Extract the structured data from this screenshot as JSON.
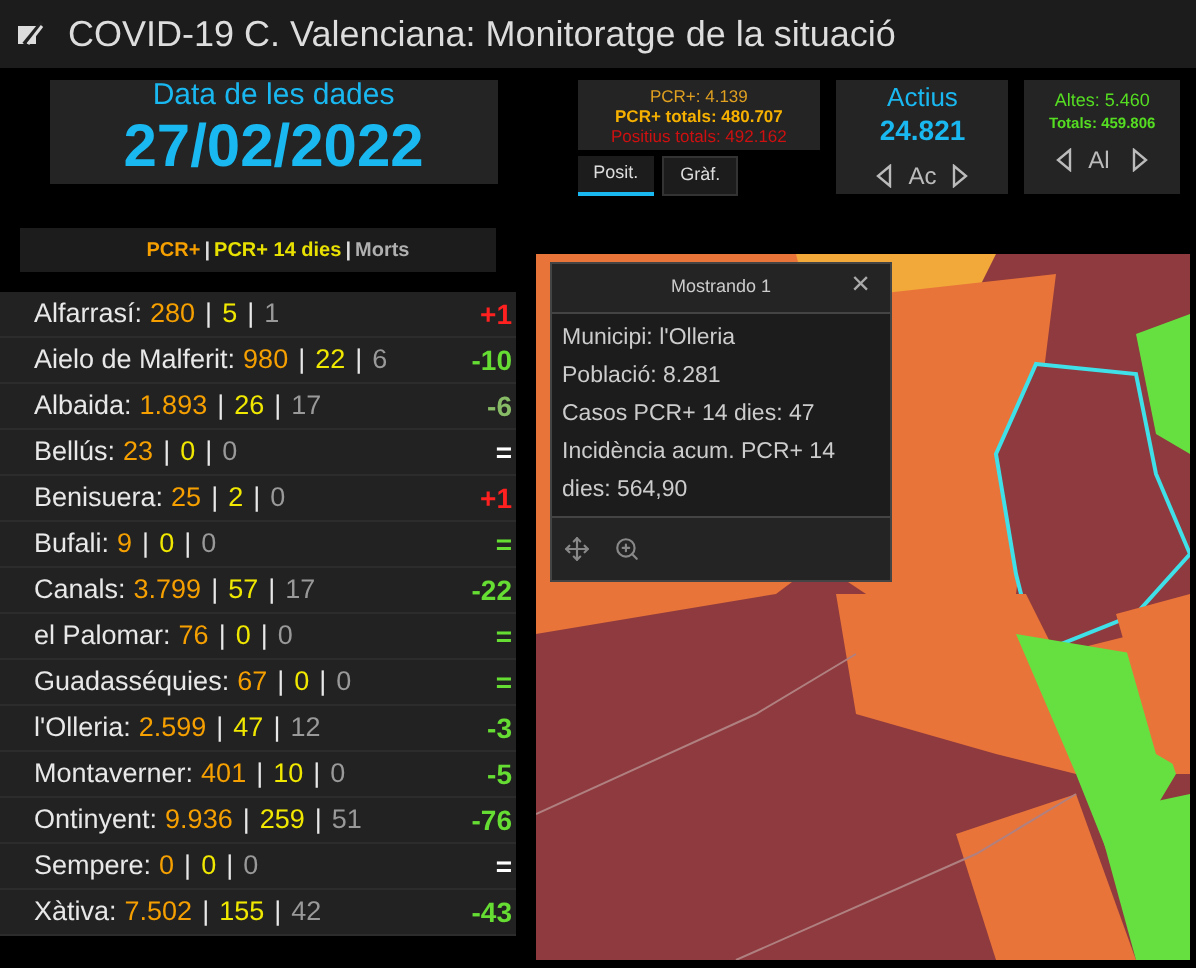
{
  "header": {
    "title": "COVID-19 C. Valenciana: Monitoratge de la situació"
  },
  "date_card": {
    "label": "Data de les dades",
    "value": "27/02/2022"
  },
  "pcr_card": {
    "lines": [
      {
        "text": "PCR+: 4.139",
        "color": "#e0a020",
        "bold": false
      },
      {
        "text": "PCR+ totals: 480.707",
        "color": "#f5b000",
        "bold": true
      },
      {
        "text": "Positius totals: 492.162",
        "color": "#d01010",
        "bold": false
      }
    ]
  },
  "pcr_tabs": [
    {
      "label": "Posit.",
      "selected": true
    },
    {
      "label": "Gràf.",
      "selected": false
    }
  ],
  "active_card": {
    "label": "Actius",
    "value": "24.821",
    "nav_label": "Ac"
  },
  "recovered_card": {
    "lines": [
      {
        "text": "Altes: 5.460",
        "bold": false
      },
      {
        "text": "Totals: 459.806",
        "bold": true
      }
    ],
    "nav_label": "Al"
  },
  "legend": [
    {
      "text": "PCR+",
      "color": "#f5a000"
    },
    {
      "text": "PCR+ 14 dies",
      "color": "#e8e000"
    },
    {
      "text": "Morts",
      "color": "#b0b0b0"
    }
  ],
  "legend_separator": "|",
  "row_separator": "|",
  "rows": [
    {
      "label": "Alfarrasí:",
      "pcr": "280",
      "pcr14": "5",
      "deaths": "1",
      "change": "+1",
      "color": "#ff2020"
    },
    {
      "label": "Aielo de Malferit:",
      "pcr": "980",
      "pcr14": "22",
      "deaths": "6",
      "change": "-10",
      "color": "#66dd33"
    },
    {
      "label": "Albaida:",
      "pcr": "1.893",
      "pcr14": "26",
      "deaths": "17",
      "change": "-6",
      "color": "#88bb66"
    },
    {
      "label": "Bellús:",
      "pcr": "23",
      "pcr14": "0",
      "deaths": "0",
      "change": "=",
      "color": "#ffffff"
    },
    {
      "label": "Benisuera:",
      "pcr": "25",
      "pcr14": "2",
      "deaths": "0",
      "change": "+1",
      "color": "#ff2020"
    },
    {
      "label": "Bufali:",
      "pcr": "9",
      "pcr14": "0",
      "deaths": "0",
      "change": "=",
      "color": "#66dd33"
    },
    {
      "label": "Canals:",
      "pcr": "3.799",
      "pcr14": "57",
      "deaths": "17",
      "change": "-22",
      "color": "#66dd33"
    },
    {
      "label": "el Palomar:",
      "pcr": "76",
      "pcr14": "0",
      "deaths": "0",
      "change": "=",
      "color": "#66dd33"
    },
    {
      "label": "Guadasséquies:",
      "pcr": "67",
      "pcr14": "0",
      "deaths": "0",
      "change": "=",
      "color": "#66dd33"
    },
    {
      "label": "l'Olleria:",
      "pcr": "2.599",
      "pcr14": "47",
      "deaths": "12",
      "change": "-3",
      "color": "#66dd33"
    },
    {
      "label": "Montaverner:",
      "pcr": "401",
      "pcr14": "10",
      "deaths": "0",
      "change": "-5",
      "color": "#66dd33"
    },
    {
      "label": "Ontinyent:",
      "pcr": "9.936",
      "pcr14": "259",
      "deaths": "51",
      "change": "-76",
      "color": "#66dd33"
    },
    {
      "label": "Sempere:",
      "pcr": "0",
      "pcr14": "0",
      "deaths": "0",
      "change": "=",
      "color": "#ffffff"
    },
    {
      "label": "Xàtiva:",
      "pcr": "7.502",
      "pcr14": "155",
      "deaths": "42",
      "change": "-43",
      "color": "#66dd33"
    }
  ],
  "popup": {
    "title": "Mostrando 1",
    "close": "×",
    "lines": [
      "Municipi: l'Olleria",
      "Població: 8.281",
      "Casos PCR+ 14 dies: 47",
      "Incidència acum. PCR+ 14 dies: 564,90"
    ]
  }
}
